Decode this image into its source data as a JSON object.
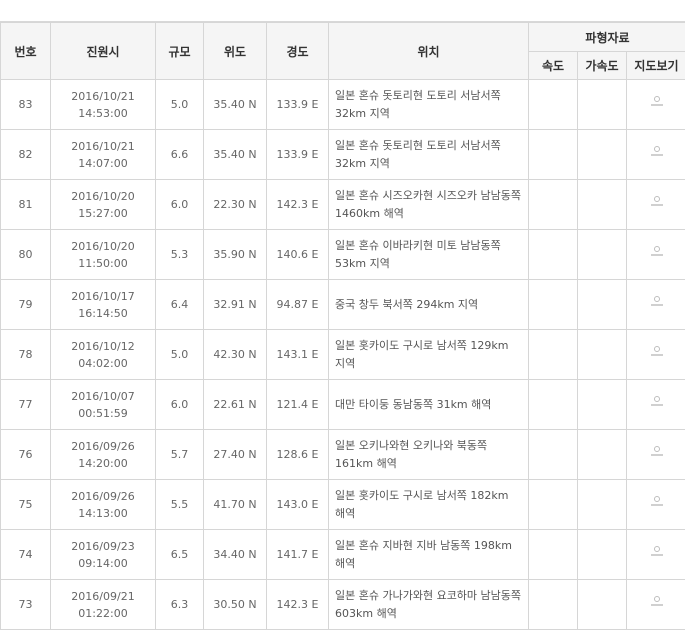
{
  "headers": {
    "no": "번호",
    "time": "진원시",
    "mag": "규모",
    "lat": "위도",
    "lon": "경도",
    "location": "위치",
    "waveform": "파형자료",
    "velocity": "속도",
    "acceleration": "가속도",
    "map": "지도보기"
  },
  "rows": [
    {
      "no": "83",
      "date": "2016/10/21",
      "time": "14:53:00",
      "mag": "5.0",
      "lat": "35.40 N",
      "lon": "133.9 E",
      "location": "일본 혼슈 돗토리현 도토리 서남서쪽 32km 지역",
      "map_icon": "map-view-icon"
    },
    {
      "no": "82",
      "date": "2016/10/21",
      "time": "14:07:00",
      "mag": "6.6",
      "lat": "35.40 N",
      "lon": "133.9 E",
      "location": "일본 혼슈 돗토리현 도토리 서남서쪽 32km 지역",
      "map_icon": "map-view-icon"
    },
    {
      "no": "81",
      "date": "2016/10/20",
      "time": "15:27:00",
      "mag": "6.0",
      "lat": "22.30 N",
      "lon": "142.3 E",
      "location": "일본 혼슈 시즈오카현 시즈오카 남남동쪽 1460km 해역",
      "map_icon": "map-view-icon"
    },
    {
      "no": "80",
      "date": "2016/10/20",
      "time": "11:50:00",
      "mag": "5.3",
      "lat": "35.90 N",
      "lon": "140.6 E",
      "location": "일본 혼슈 이바라키현 미토 남남동쪽 53km 지역",
      "map_icon": "map-view-icon"
    },
    {
      "no": "79",
      "date": "2016/10/17",
      "time": "16:14:50",
      "mag": "6.4",
      "lat": "32.91 N",
      "lon": "94.87 E",
      "location": "중국 창두 북서쪽 294km 지역",
      "map_icon": "map-view-icon"
    },
    {
      "no": "78",
      "date": "2016/10/12",
      "time": "04:02:00",
      "mag": "5.0",
      "lat": "42.30 N",
      "lon": "143.1 E",
      "location": "일본 홋카이도 구시로 남서쪽 129km 지역",
      "map_icon": "map-view-icon"
    },
    {
      "no": "77",
      "date": "2016/10/07",
      "time": "00:51:59",
      "mag": "6.0",
      "lat": "22.61 N",
      "lon": "121.4 E",
      "location": "대만 타이둥 동남동쪽 31km 해역",
      "map_icon": "map-view-icon"
    },
    {
      "no": "76",
      "date": "2016/09/26",
      "time": "14:20:00",
      "mag": "5.7",
      "lat": "27.40 N",
      "lon": "128.6 E",
      "location": "일본 오키나와현 오키나와 북동쪽 161km 해역",
      "map_icon": "map-view-icon"
    },
    {
      "no": "75",
      "date": "2016/09/26",
      "time": "14:13:00",
      "mag": "5.5",
      "lat": "41.70 N",
      "lon": "143.0 E",
      "location": "일본 홋카이도 구시로 남서쪽 182km 해역",
      "map_icon": "map-view-icon"
    },
    {
      "no": "74",
      "date": "2016/09/23",
      "time": "09:14:00",
      "mag": "6.5",
      "lat": "34.40 N",
      "lon": "141.7 E",
      "location": "일본 혼슈 지바현 지바 남동쪽 198km 해역",
      "map_icon": "map-view-icon"
    },
    {
      "no": "73",
      "date": "2016/09/21",
      "time": "01:22:00",
      "mag": "6.3",
      "lat": "30.50 N",
      "lon": "142.3 E",
      "location": "일본 혼슈 가나가와현 요코하마 남남동쪽 603km 해역",
      "map_icon": "map-view-icon"
    }
  ]
}
